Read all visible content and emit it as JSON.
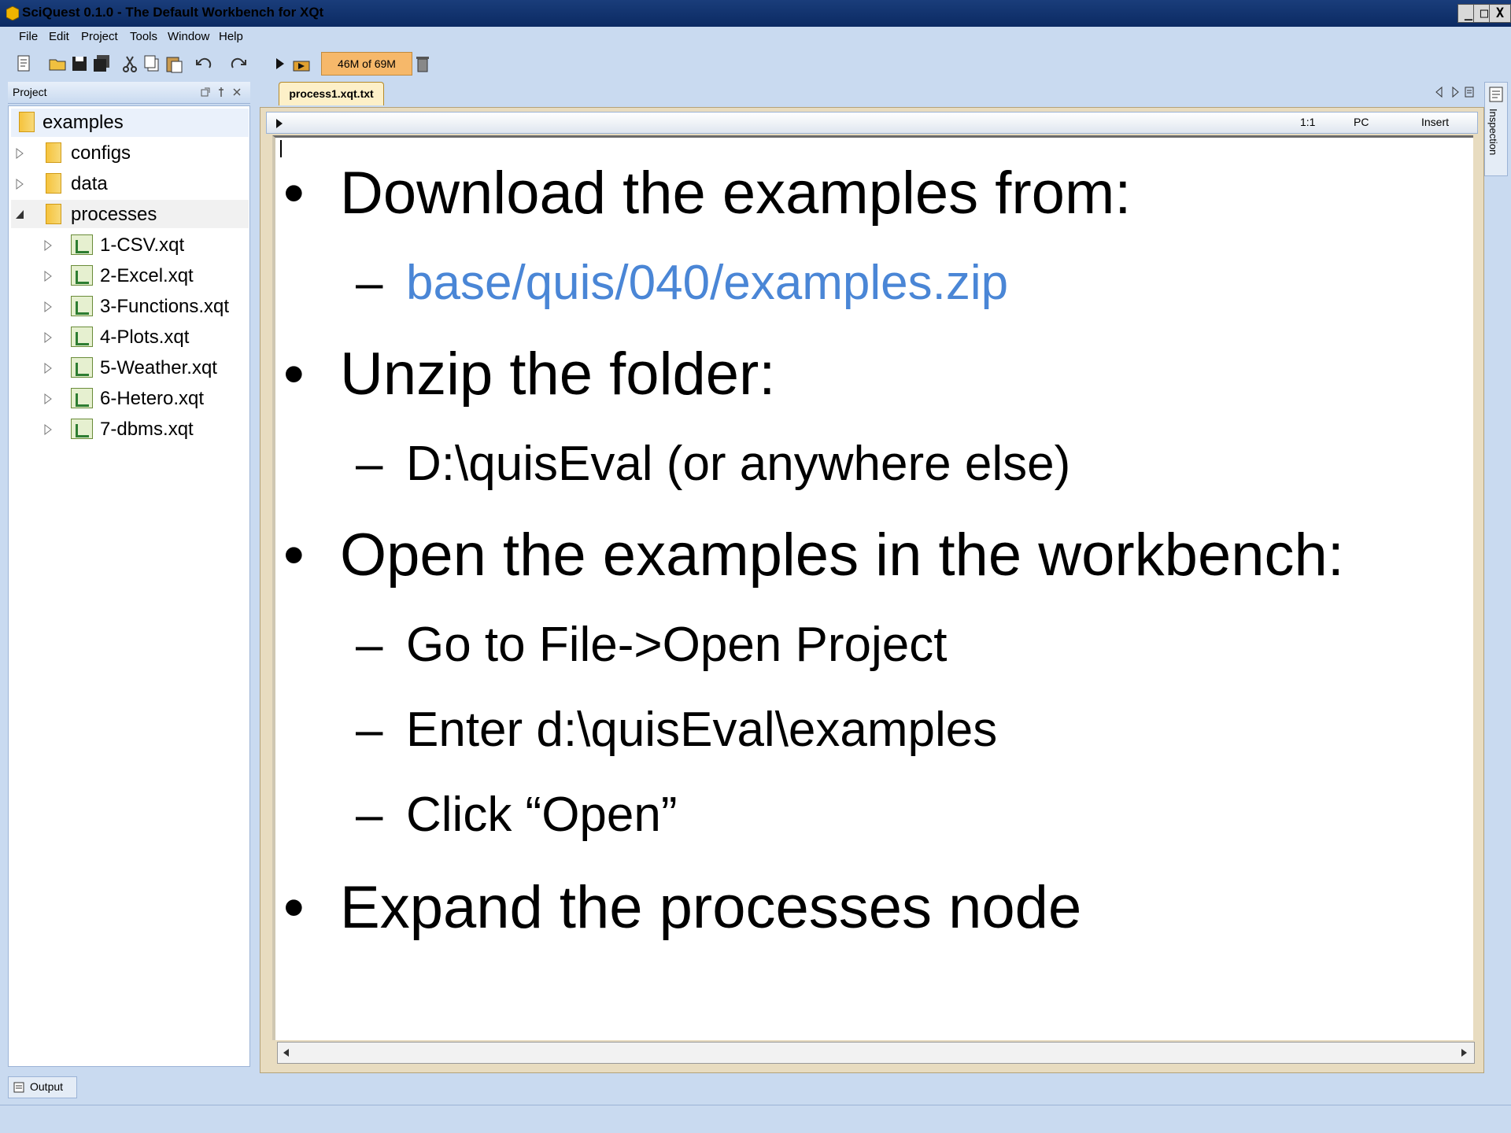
{
  "window": {
    "title": "SciQuest 0.1.0 - The Default Workbench for XQt",
    "controls": [
      "_",
      "□",
      "X"
    ]
  },
  "menu": [
    "File",
    "Edit",
    "Project",
    "Tools",
    "Window",
    "Help"
  ],
  "toolbar": {
    "memory": "46M of 69M"
  },
  "project_panel": {
    "title": "Project",
    "tree": {
      "root": "examples",
      "folders": [
        "configs",
        "data",
        "processes"
      ],
      "processes": [
        "1-CSV.xqt",
        "2-Excel.xqt",
        "3-Functions.xqt",
        "4-Plots.xqt",
        "5-Weather.xqt",
        "6-Hetero.xqt",
        "7-dbms.xqt"
      ]
    }
  },
  "editor": {
    "tab": "process1.xqt.txt",
    "status": {
      "position": "1:1",
      "line_ending": "PC",
      "mode": "Insert"
    },
    "content": [
      {
        "level": 1,
        "text": "Download the examples from:"
      },
      {
        "level": 2,
        "text": "base/quis/040/examples.zip",
        "link": true
      },
      {
        "level": 1,
        "text": "Unzip the folder:"
      },
      {
        "level": 2,
        "text": "D:\\quisEval (or anywhere else)"
      },
      {
        "level": 1,
        "text": "Open the examples in the workbench:"
      },
      {
        "level": 2,
        "text": "Go to File->Open Project"
      },
      {
        "level": 2,
        "text": "Enter d:\\quisEval\\examples"
      },
      {
        "level": 2,
        "text": "Click “Open”"
      },
      {
        "level": 1,
        "text": "Expand the processes node"
      }
    ]
  },
  "side_strip": {
    "label": "Inspection"
  },
  "bottom": {
    "output_tab": "Output"
  },
  "colors": {
    "link": "#4a86d6",
    "titlebar": "#0b2a63",
    "chrome": "#c9daf0"
  }
}
